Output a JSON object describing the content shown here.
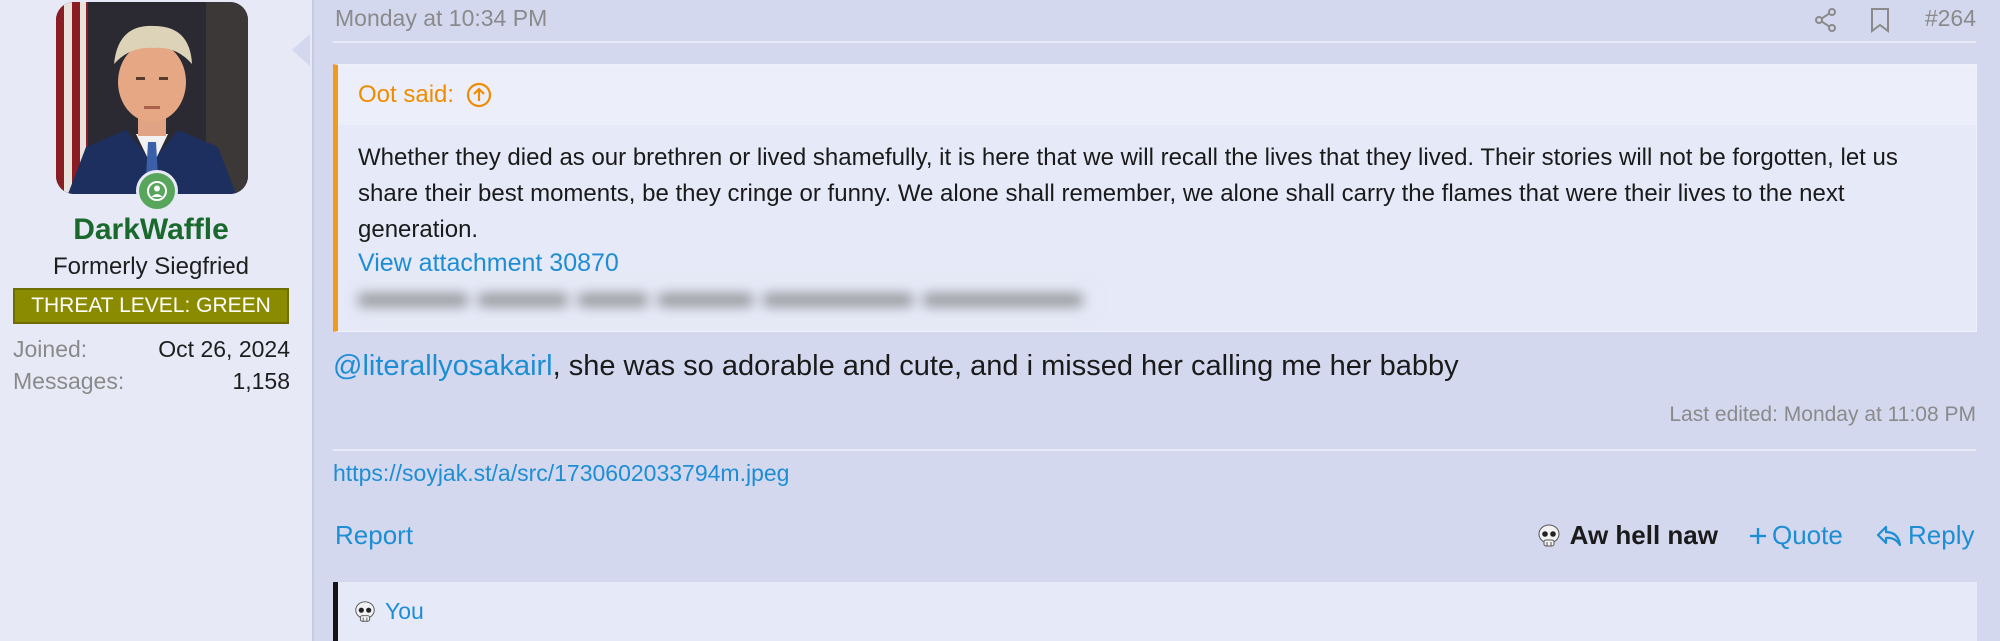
{
  "user": {
    "name": "DarkWaffle",
    "title": "Formerly Siegfried",
    "banner": "THREAT LEVEL: GREEN",
    "stats": [
      {
        "label": "Joined:",
        "value": "Oct 26, 2024"
      },
      {
        "label": "Messages:",
        "value": "1,158"
      }
    ],
    "online": true
  },
  "post": {
    "date": "Monday at 10:34 PM",
    "number": "#264",
    "quote": {
      "author": "Oot said:",
      "body": "Whether they died as our brethren or lived shamefully, it is here that we will recall the lives that they lived. Their stories will not be forgotten, let us share their best moments, be they cringe or funny. We alone shall remember, we alone shall carry the flames that were their lives to the next generation.",
      "attachment_link": "View attachment 30870"
    },
    "mention": "@literallyosakairl",
    "message": ", she was so adorable and cute, and i missed her calling me her babby",
    "edited": "Last edited: Monday at 11:08 PM",
    "signature_url": "https://soyjak.st/a/src/1730602033794m.jpeg"
  },
  "actions": {
    "report": "Report",
    "reaction": "Aw hell naw",
    "quote": "Quote",
    "reply": "Reply"
  },
  "reactions_bar": {
    "who": "You"
  },
  "icons": [
    "share-icon",
    "bookmark-icon",
    "arrow-up-circle-icon",
    "skull-icon",
    "plus-icon",
    "reply-arrow-icon",
    "online-status-icon"
  ],
  "colors": {
    "username": "#19682c",
    "banner": "#8b8b00",
    "link": "#1d8ed4",
    "quote_accent": "#f39a1c",
    "online": "#58a55c"
  }
}
